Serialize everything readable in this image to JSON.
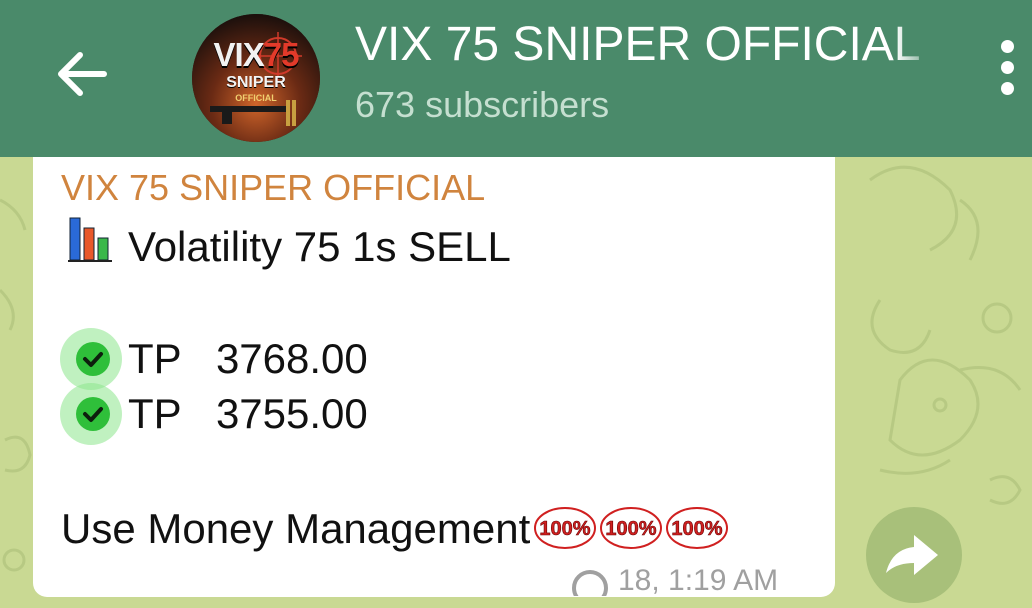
{
  "header": {
    "back_icon": "arrow-left-icon",
    "channel_title": "VIX 75 SNIPER OFFICIAL",
    "subscribers": "673 subscribers",
    "menu_icon": "more-vertical-icon",
    "avatar": {
      "logo_main_white": "VIX",
      "logo_main_red": "75",
      "logo_sub": "SNIPER",
      "logo_sub2": "OFFICIAL"
    },
    "colors": {
      "background": "#4a8a6a"
    }
  },
  "message": {
    "sender": "VIX 75 SNIPER OFFICIAL",
    "signal_icon": "bar-chart-icon",
    "signal_text": "Volatility 75 1s SELL",
    "take_profits": [
      {
        "label": "TP",
        "value": "3768.00",
        "icon": "check-mark-icon"
      },
      {
        "label": "TP",
        "value": "3755.00",
        "icon": "check-mark-icon"
      }
    ],
    "footer_text": "Use Money Management",
    "badges": [
      "100%",
      "100%",
      "100%"
    ],
    "time": "18, 1:19 AM",
    "colors": {
      "sender": "#d0843e",
      "bubble": "#ffffff"
    }
  },
  "share_button": {
    "icon": "forward-icon"
  }
}
